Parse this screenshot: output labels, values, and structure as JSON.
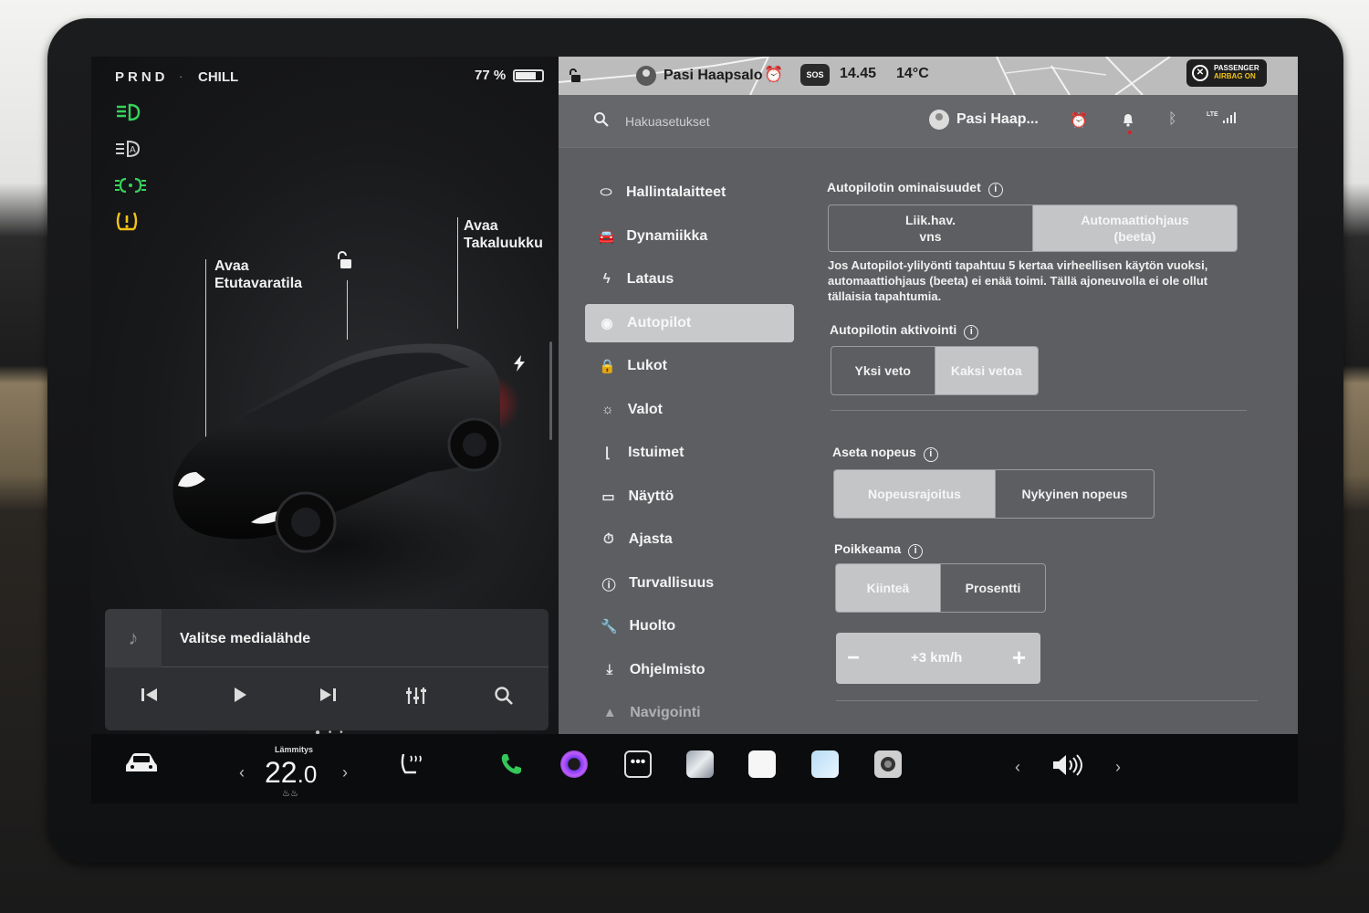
{
  "status": {
    "gear": "PRND",
    "drive_mode": "CHILL",
    "battery_text": "77 %",
    "battery_level": 0.77
  },
  "car_view": {
    "frunk_label_1": "Avaa",
    "frunk_label_2": "Etutavaratila",
    "trunk_label_1": "Avaa",
    "trunk_label_2": "Takaluukku"
  },
  "media": {
    "title": "Valitse medialähde"
  },
  "topbar": {
    "profile_name": "Pasi Haapsalo",
    "sos_label": "SOS",
    "time": "14.45",
    "outside_temp": "14°C",
    "airbag_line1": "PASSENGER",
    "airbag_line2": "AIRBAG ON"
  },
  "settings": {
    "search_placeholder": "Hakuasetukset",
    "profile_short": "Pasi Haap...",
    "signal_label": "LTE",
    "menu": [
      {
        "label": "Hallintalaitteet",
        "icon": "toggle-icon"
      },
      {
        "label": "Dynamiikka",
        "icon": "car-icon"
      },
      {
        "label": "Lataus",
        "icon": "bolt-icon"
      },
      {
        "label": "Autopilot",
        "icon": "steering-wheel-icon"
      },
      {
        "label": "Lukot",
        "icon": "lock-icon"
      },
      {
        "label": "Valot",
        "icon": "sun-icon"
      },
      {
        "label": "Istuimet",
        "icon": "seat-icon"
      },
      {
        "label": "Näyttö",
        "icon": "display-icon"
      },
      {
        "label": "Ajasta",
        "icon": "alarm-icon"
      },
      {
        "label": "Turvallisuus",
        "icon": "info-circle-icon"
      },
      {
        "label": "Huolto",
        "icon": "wrench-icon"
      },
      {
        "label": "Ohjelmisto",
        "icon": "download-icon"
      },
      {
        "label": "Navigointi",
        "icon": "navigation-icon"
      }
    ],
    "autopilot_features": {
      "title": "Autopilotin ominaisuudet",
      "options": [
        "Liik.hav.\nvns",
        "Automaattiohjaus\n(beeta)"
      ],
      "selected": 1,
      "description": "Jos Autopilot-ylilyönti tapahtuu 5 kertaa virheellisen käytön vuoksi, automaattiohjaus (beeta) ei enää toimi. Tällä ajoneuvolla ei ole ollut tällaisia tapahtumia."
    },
    "autopilot_activation": {
      "title": "Autopilotin aktivointi",
      "options": [
        "Yksi veto",
        "Kaksi vetoa"
      ],
      "selected": 1
    },
    "set_speed": {
      "title": "Aseta nopeus",
      "options": [
        "Nopeusrajoitus",
        "Nykyinen nopeus"
      ],
      "selected": 0
    },
    "offset": {
      "title": "Poikkeama",
      "options": [
        "Kiinteä",
        "Prosentti"
      ],
      "selected": 0,
      "value": "+3 km/h"
    }
  },
  "bottom_bar": {
    "temp_label": "Lämmitys",
    "temp_whole": "22",
    "temp_frac": ".0"
  },
  "colors": {
    "right_bg": "#5d5e62",
    "selected_segment": "#c4c5c7",
    "alarm_yellow": "#d9a000",
    "phone_green": "#34c759"
  }
}
